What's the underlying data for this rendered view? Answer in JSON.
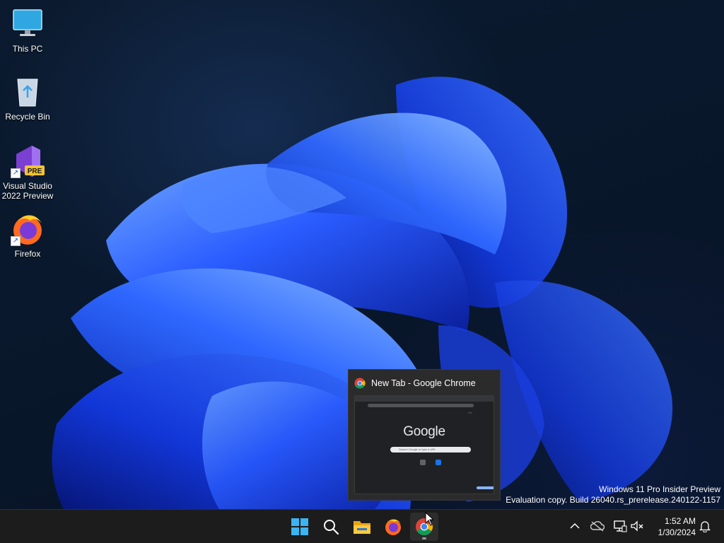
{
  "desktop": {
    "icons": [
      {
        "label": "This PC",
        "icon": "monitor-icon"
      },
      {
        "label": "Recycle Bin",
        "icon": "recycle-bin-icon"
      },
      {
        "label": "Visual Studio 2022 Preview",
        "icon": "visual-studio-icon",
        "badge": "PRE"
      },
      {
        "label": "Firefox",
        "icon": "firefox-icon"
      }
    ]
  },
  "watermark": {
    "line1": "Windows 11 Pro Insider Preview",
    "line2": "Evaluation copy. Build 26040.rs_prerelease.240122-1157"
  },
  "thumbnail": {
    "title": "New Tab - Google Chrome",
    "preview": {
      "logo": "Google",
      "search_placeholder": "Search Google or type a URL"
    }
  },
  "taskbar": {
    "apps": [
      {
        "name": "Start",
        "icon": "windows-start-icon"
      },
      {
        "name": "Search",
        "icon": "search-icon"
      },
      {
        "name": "File Explorer",
        "icon": "folder-icon"
      },
      {
        "name": "Firefox",
        "icon": "firefox-icon"
      },
      {
        "name": "Google Chrome",
        "icon": "chrome-icon",
        "active": true
      }
    ],
    "tray": {
      "time": "1:52 AM",
      "date": "1/30/2024"
    }
  },
  "colors": {
    "taskbar_bg": "#1c1c1c",
    "accent_blue": "#1f6fff",
    "windows_blue": "#3ab4f2"
  }
}
